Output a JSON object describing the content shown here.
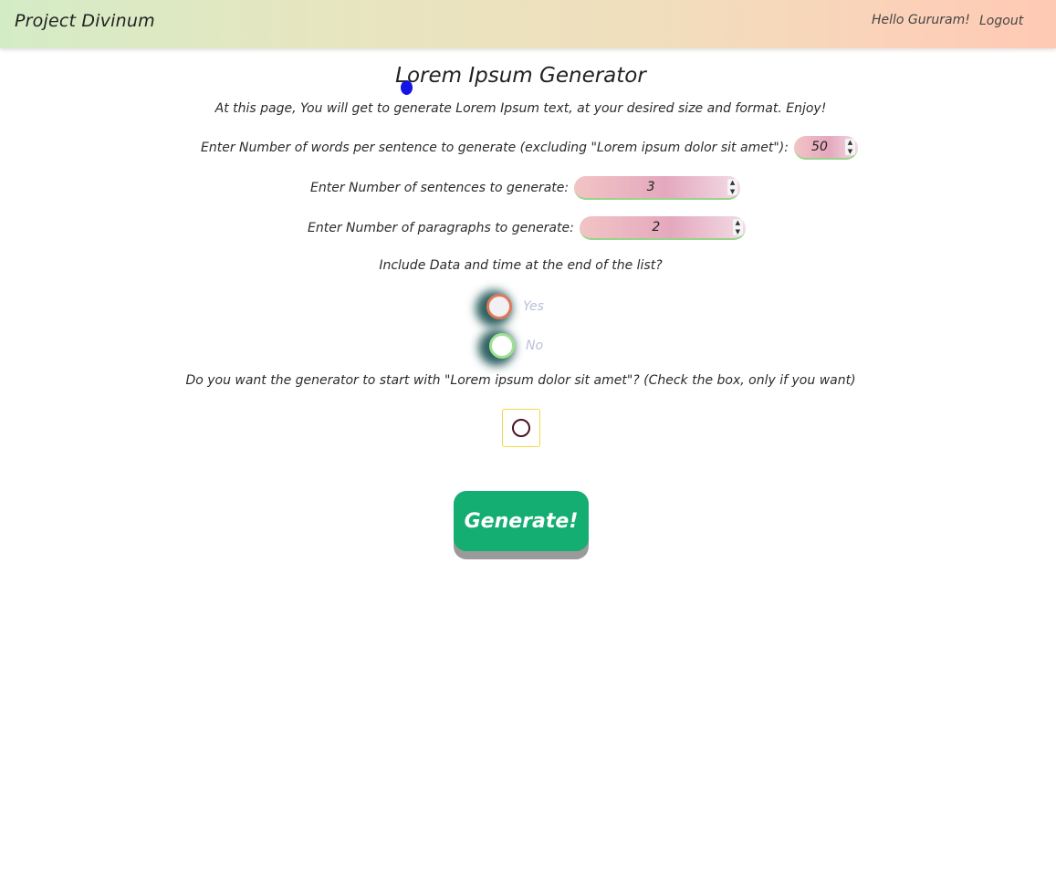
{
  "navbar": {
    "brand": "Project Divinum",
    "greeting": "Hello Gururam!",
    "logout_label": "Logout"
  },
  "page": {
    "title": "Lorem Ipsum Generator",
    "intro": "At this page, You will get to generate Lorem Ipsum text, at your desired size and format. Enjoy!"
  },
  "form": {
    "words_label": "Enter Number of words per sentence to generate (excluding \"Lorem ipsum dolor sit amet\"):",
    "words_value": "50",
    "sentences_label": "Enter Number of sentences to generate:",
    "sentences_value": "3",
    "paragraphs_label": "Enter Number of paragraphs to generate:",
    "paragraphs_value": "2",
    "datetime_question": "Include Data and time at the end of the list?",
    "option_yes": "Yes",
    "option_no": "No",
    "lorem_start_question": "Do you want the generator to start with \"Lorem ipsum dolor sit amet\"? (Check the box, only if you want)",
    "generate_label": "Generate!"
  },
  "colors": {
    "navbar_gradient_start": "#d4ecc6",
    "navbar_gradient_end": "#ffc9b4",
    "generate_button": "#14ad72",
    "radio_yes_border": "#e0785b",
    "radio_no_border": "#9ee290",
    "checkbox_border": "#f0d74b"
  }
}
